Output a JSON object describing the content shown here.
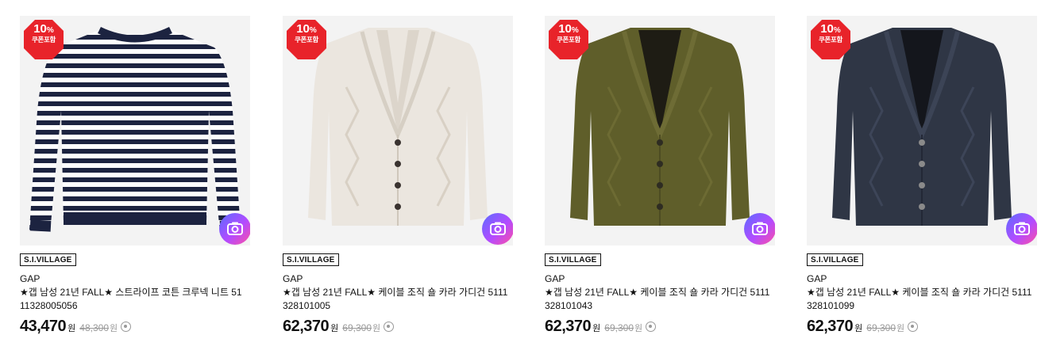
{
  "products": [
    {
      "badge": {
        "percent": "10",
        "unit": "%",
        "label": "쿠폰포함"
      },
      "vendor": "S.I.VILLAGE",
      "brand": "GAP",
      "title_line1": "★갭 남성 21년 FALL★ 스트라이프 코튼 크루넥 니트 51",
      "title_line2": "11328005056",
      "price": "43,470",
      "price_unit": "원",
      "original_price": "48,300",
      "original_unit": "원",
      "image_icon": "striped-crewneck-sweater-image"
    },
    {
      "badge": {
        "percent": "10",
        "unit": "%",
        "label": "쿠폰포함"
      },
      "vendor": "S.I.VILLAGE",
      "brand": "GAP",
      "title_line1": "★갭 남성 21년 FALL★ 케이블 조직 숄 카라 가디건 5111",
      "title_line2": "328101005",
      "price": "62,370",
      "price_unit": "원",
      "original_price": "69,300",
      "original_unit": "원",
      "image_icon": "cream-cardigan-image"
    },
    {
      "badge": {
        "percent": "10",
        "unit": "%",
        "label": "쿠폰포함"
      },
      "vendor": "S.I.VILLAGE",
      "brand": "GAP",
      "title_line1": "★갭 남성 21년 FALL★ 케이블 조직 숄 카라 가디건 5111",
      "title_line2": "328101043",
      "price": "62,370",
      "price_unit": "원",
      "original_price": "69,300",
      "original_unit": "원",
      "image_icon": "olive-cardigan-image"
    },
    {
      "badge": {
        "percent": "10",
        "unit": "%",
        "label": "쿠폰포함"
      },
      "vendor": "S.I.VILLAGE",
      "brand": "GAP",
      "title_line1": "★갭 남성 21년 FALL★ 케이블 조직 숄 카라 가디건 5111",
      "title_line2": "328101099",
      "price": "62,370",
      "price_unit": "원",
      "original_price": "69,300",
      "original_unit": "원",
      "image_icon": "navy-cardigan-image"
    }
  ],
  "colors": {
    "badge_red": "#e8232a",
    "cardigan_cream": "#ebe6df",
    "cardigan_olive": "#5f5e2a",
    "cardigan_navy": "#2f3645",
    "stripe_navy": "#1c2340"
  }
}
